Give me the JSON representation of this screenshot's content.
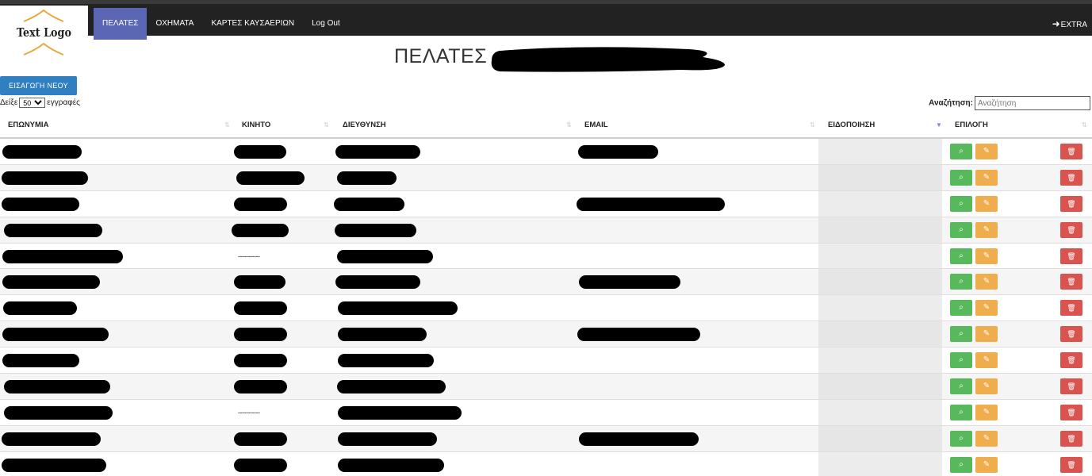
{
  "logo": {
    "text": "Text Logo"
  },
  "nav": {
    "items": [
      {
        "label": "ΠΕΛΑΤΕΣ",
        "active": true
      },
      {
        "label": "ΟΧΗΜΑΤΑ",
        "active": false
      },
      {
        "label": "ΚΑΡΤΕΣ ΚΑΥΣΑΕΡΙΩΝ",
        "active": false
      },
      {
        "label": "Log Out",
        "active": false
      }
    ],
    "extra_label": "EXTRA",
    "extra_icon": "sign-in-icon"
  },
  "page": {
    "title": "ΠΕΛΑΤΕΣ"
  },
  "toolbar": {
    "new_button": "ΕΙΣΑΓΩΓΗ ΝΕΟΥ",
    "length_prefix": "Δείξε",
    "length_value": "50",
    "length_suffix": "εγγραφές",
    "search_label": "Αναζήτηση:",
    "search_placeholder": "Αναζήτηση"
  },
  "table": {
    "columns": [
      "ΕΠΩΝΥΜΙΑ",
      "ΚΙΝΗΤΟ",
      "ΔΙΕΥΘΥΝΣΗ",
      "EMAIL",
      "ΕΙΔΟΠΟΙΗΣΗ",
      "ΕΠΙΛΟΓΗ"
    ],
    "sorted_column": "ΕΙΔΟΠΟΙΗΣΗ",
    "placeholder_phone": "-----------",
    "rows": [
      {
        "name": "[redacted]",
        "phone": "[redacted]",
        "address": "[redacted]",
        "email": "[redacted]"
      },
      {
        "name": "[redacted]",
        "phone": "[redacted]",
        "address": "[redacted]",
        "email": ""
      },
      {
        "name": "[redacted]",
        "phone": "[redacted]",
        "address": "[redacted]",
        "email": "[redacted]"
      },
      {
        "name": "[redacted]",
        "phone": "[redacted]",
        "address": "[redacted]",
        "email": ""
      },
      {
        "name": "[redacted]",
        "phone": "-----------",
        "address": "[redacted]",
        "email": ""
      },
      {
        "name": "[redacted]",
        "phone": "[redacted]",
        "address": "[redacted]",
        "email": "[redacted]"
      },
      {
        "name": "[redacted]",
        "phone": "[redacted]",
        "address": "[redacted]",
        "email": ""
      },
      {
        "name": "[redacted]",
        "phone": "[redacted]",
        "address": "[redacted]",
        "email": "[redacted]"
      },
      {
        "name": "[redacted]",
        "phone": "[redacted]",
        "address": "[redacted]",
        "email": ""
      },
      {
        "name": "[redacted]",
        "phone": "[redacted]",
        "address": "[redacted]",
        "email": ""
      },
      {
        "name": "[redacted]",
        "phone": "-----------",
        "address": "[redacted]",
        "email": ""
      },
      {
        "name": "[redacted]",
        "phone": "[redacted]",
        "address": "[redacted]",
        "email": "[redacted]"
      },
      {
        "name": "[redacted]",
        "phone": "[redacted]",
        "address": "[redacted]",
        "email": ""
      }
    ],
    "row_actions": [
      "search-icon",
      "pencil-icon",
      "trash-icon"
    ]
  },
  "colors": {
    "nav_bg": "#222222",
    "nav_active": "#5b67b5",
    "primary": "#2f7fc1",
    "success": "#58b85c",
    "warning": "#f0ad4e",
    "danger": "#d9534f"
  }
}
